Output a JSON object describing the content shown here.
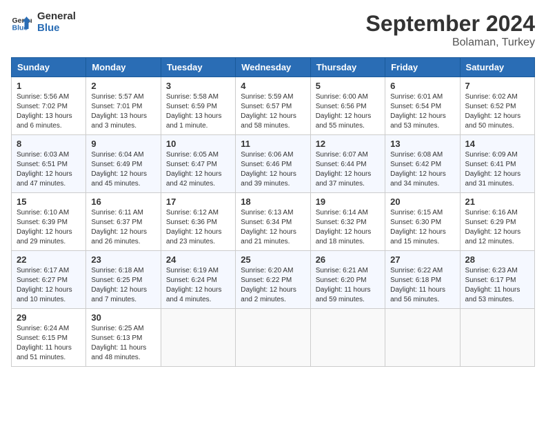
{
  "header": {
    "logo_line1": "General",
    "logo_line2": "Blue",
    "month_year": "September 2024",
    "location": "Bolaman, Turkey"
  },
  "weekdays": [
    "Sunday",
    "Monday",
    "Tuesday",
    "Wednesday",
    "Thursday",
    "Friday",
    "Saturday"
  ],
  "weeks": [
    [
      {
        "day": "1",
        "detail": "Sunrise: 5:56 AM\nSunset: 7:02 PM\nDaylight: 13 hours\nand 6 minutes."
      },
      {
        "day": "2",
        "detail": "Sunrise: 5:57 AM\nSunset: 7:01 PM\nDaylight: 13 hours\nand 3 minutes."
      },
      {
        "day": "3",
        "detail": "Sunrise: 5:58 AM\nSunset: 6:59 PM\nDaylight: 13 hours\nand 1 minute."
      },
      {
        "day": "4",
        "detail": "Sunrise: 5:59 AM\nSunset: 6:57 PM\nDaylight: 12 hours\nand 58 minutes."
      },
      {
        "day": "5",
        "detail": "Sunrise: 6:00 AM\nSunset: 6:56 PM\nDaylight: 12 hours\nand 55 minutes."
      },
      {
        "day": "6",
        "detail": "Sunrise: 6:01 AM\nSunset: 6:54 PM\nDaylight: 12 hours\nand 53 minutes."
      },
      {
        "day": "7",
        "detail": "Sunrise: 6:02 AM\nSunset: 6:52 PM\nDaylight: 12 hours\nand 50 minutes."
      }
    ],
    [
      {
        "day": "8",
        "detail": "Sunrise: 6:03 AM\nSunset: 6:51 PM\nDaylight: 12 hours\nand 47 minutes."
      },
      {
        "day": "9",
        "detail": "Sunrise: 6:04 AM\nSunset: 6:49 PM\nDaylight: 12 hours\nand 45 minutes."
      },
      {
        "day": "10",
        "detail": "Sunrise: 6:05 AM\nSunset: 6:47 PM\nDaylight: 12 hours\nand 42 minutes."
      },
      {
        "day": "11",
        "detail": "Sunrise: 6:06 AM\nSunset: 6:46 PM\nDaylight: 12 hours\nand 39 minutes."
      },
      {
        "day": "12",
        "detail": "Sunrise: 6:07 AM\nSunset: 6:44 PM\nDaylight: 12 hours\nand 37 minutes."
      },
      {
        "day": "13",
        "detail": "Sunrise: 6:08 AM\nSunset: 6:42 PM\nDaylight: 12 hours\nand 34 minutes."
      },
      {
        "day": "14",
        "detail": "Sunrise: 6:09 AM\nSunset: 6:41 PM\nDaylight: 12 hours\nand 31 minutes."
      }
    ],
    [
      {
        "day": "15",
        "detail": "Sunrise: 6:10 AM\nSunset: 6:39 PM\nDaylight: 12 hours\nand 29 minutes."
      },
      {
        "day": "16",
        "detail": "Sunrise: 6:11 AM\nSunset: 6:37 PM\nDaylight: 12 hours\nand 26 minutes."
      },
      {
        "day": "17",
        "detail": "Sunrise: 6:12 AM\nSunset: 6:36 PM\nDaylight: 12 hours\nand 23 minutes."
      },
      {
        "day": "18",
        "detail": "Sunrise: 6:13 AM\nSunset: 6:34 PM\nDaylight: 12 hours\nand 21 minutes."
      },
      {
        "day": "19",
        "detail": "Sunrise: 6:14 AM\nSunset: 6:32 PM\nDaylight: 12 hours\nand 18 minutes."
      },
      {
        "day": "20",
        "detail": "Sunrise: 6:15 AM\nSunset: 6:30 PM\nDaylight: 12 hours\nand 15 minutes."
      },
      {
        "day": "21",
        "detail": "Sunrise: 6:16 AM\nSunset: 6:29 PM\nDaylight: 12 hours\nand 12 minutes."
      }
    ],
    [
      {
        "day": "22",
        "detail": "Sunrise: 6:17 AM\nSunset: 6:27 PM\nDaylight: 12 hours\nand 10 minutes."
      },
      {
        "day": "23",
        "detail": "Sunrise: 6:18 AM\nSunset: 6:25 PM\nDaylight: 12 hours\nand 7 minutes."
      },
      {
        "day": "24",
        "detail": "Sunrise: 6:19 AM\nSunset: 6:24 PM\nDaylight: 12 hours\nand 4 minutes."
      },
      {
        "day": "25",
        "detail": "Sunrise: 6:20 AM\nSunset: 6:22 PM\nDaylight: 12 hours\nand 2 minutes."
      },
      {
        "day": "26",
        "detail": "Sunrise: 6:21 AM\nSunset: 6:20 PM\nDaylight: 11 hours\nand 59 minutes."
      },
      {
        "day": "27",
        "detail": "Sunrise: 6:22 AM\nSunset: 6:18 PM\nDaylight: 11 hours\nand 56 minutes."
      },
      {
        "day": "28",
        "detail": "Sunrise: 6:23 AM\nSunset: 6:17 PM\nDaylight: 11 hours\nand 53 minutes."
      }
    ],
    [
      {
        "day": "29",
        "detail": "Sunrise: 6:24 AM\nSunset: 6:15 PM\nDaylight: 11 hours\nand 51 minutes."
      },
      {
        "day": "30",
        "detail": "Sunrise: 6:25 AM\nSunset: 6:13 PM\nDaylight: 11 hours\nand 48 minutes."
      },
      null,
      null,
      null,
      null,
      null
    ]
  ]
}
